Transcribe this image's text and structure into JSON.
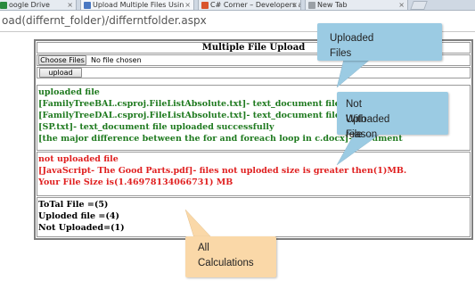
{
  "browser": {
    "tabs": [
      {
        "label": "oogle Drive",
        "icon": "drive-icon",
        "color": "#2a8a3e"
      },
      {
        "label": "Upload Multiple Files Usin",
        "icon": "page-icon",
        "color": "#4a78c2"
      },
      {
        "label": "C# Corner – Developers a",
        "icon": "csharp-corner-icon",
        "color": "#d9542c"
      },
      {
        "label": "New Tab",
        "icon": "page-icon",
        "color": "#888888"
      }
    ],
    "url": "oad(differnt_folder)/differntfolder.aspx"
  },
  "form": {
    "title": "Multiple File Upload",
    "choose_label": "Choose Files",
    "no_file_label": "No file chosen",
    "upload_label": "upload"
  },
  "uploaded": {
    "heading": "uploaded file",
    "lines": [
      "[FamilyTreeBAL.csproj.FileListAbsolute.txt]- text_document file uploaded",
      "[FamilyTreeDAL.csproj.FileListAbsolute.txt]- text_document file uploaded",
      "[SP.txt]- text_document file uploaded successfully",
      "[the major difference between the for and foreach loop in c.docx]- document"
    ],
    "color": "#1f7a1f"
  },
  "not_uploaded": {
    "heading": "not uploaded file",
    "lines": [
      "[JavaScript- The Good Parts.pdf]- files not uploded size is greater then(1)MB.",
      "Your File Size is(1.46978134066731) MB"
    ],
    "color": "#e02020"
  },
  "totals": {
    "lines": [
      "ToTal File =(5)",
      "Uploded file =(4)",
      "Not Uploaded=(1)"
    ]
  },
  "callouts": {
    "uploaded": {
      "text": "Uploaded Files",
      "color": "#9bcbe3"
    },
    "not_uploaded": {
      "lines": [
        "Not Uploaded File",
        "With reason"
      ],
      "color": "#9bcbe3"
    },
    "calculations": {
      "lines": [
        "All",
        "Calculations"
      ],
      "color": "#fad8a8"
    }
  }
}
